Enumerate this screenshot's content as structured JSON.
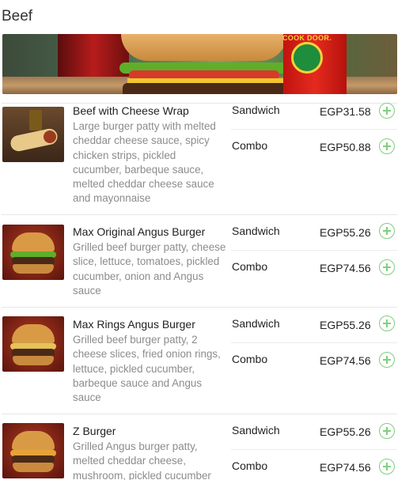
{
  "category": {
    "title": "Beef"
  },
  "banner": {
    "brand_text": "COOK DOOR."
  },
  "items": [
    {
      "name": "Beef with Cheese Wrap",
      "description": "Large burger patty with melted cheddar cheese sauce, spicy chicken strips, pickled cucumber, barbeque sauce, melted cheddar cheese sauce and mayonnaise",
      "options": [
        {
          "label": "Sandwich",
          "price": "EGP31.58"
        },
        {
          "label": "Combo",
          "price": "EGP50.88"
        }
      ]
    },
    {
      "name": "Max Original Angus Burger",
      "description": "Grilled beef burger patty, cheese slice, lettuce, tomatoes, pickled cucumber, onion and Angus sauce",
      "options": [
        {
          "label": "Sandwich",
          "price": "EGP55.26"
        },
        {
          "label": "Combo",
          "price": "EGP74.56"
        }
      ]
    },
    {
      "name": "Max Rings Angus Burger",
      "description": "Grilled beef burger patty, 2 cheese slices, fried onion rings, lettuce, pickled cucumber, barbeque sauce and Angus sauce",
      "options": [
        {
          "label": "Sandwich",
          "price": "EGP55.26"
        },
        {
          "label": "Combo",
          "price": "EGP74.56"
        }
      ]
    },
    {
      "name": "Z Burger",
      "description": "Grilled Angus burger patty, melted cheddar cheese, mushroom, pickled cucumber",
      "options": [
        {
          "label": "Sandwich",
          "price": "EGP55.26"
        },
        {
          "label": "Combo",
          "price": "EGP74.56"
        }
      ]
    }
  ],
  "colors": {
    "add_icon": "#7fcf7f",
    "description_text": "#8c8c8c"
  }
}
